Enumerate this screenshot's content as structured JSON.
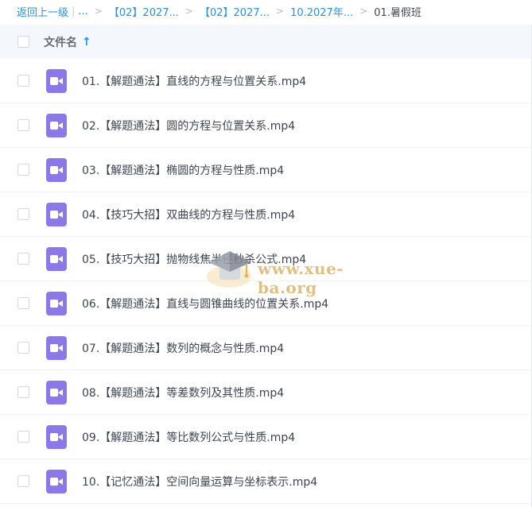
{
  "breadcrumb": {
    "back_label": "返回上一级",
    "ellipsis": "...",
    "items": [
      {
        "label": "【02】2027..."
      },
      {
        "label": "【02】2027..."
      },
      {
        "label": "10.2027年..."
      }
    ],
    "current": "01.暑假班",
    "separator": ">",
    "divider": "|"
  },
  "header": {
    "column_label": "文件名",
    "sort_icon": "arrow-up-icon",
    "sort_glyph": "↑"
  },
  "files": [
    {
      "name": "01.【解题通法】直线的方程与位置关系.mp4",
      "icon": "video-file-icon"
    },
    {
      "name": "02.【解题通法】圆的方程与位置关系.mp4",
      "icon": "video-file-icon"
    },
    {
      "name": "03.【解题通法】椭圆的方程与性质.mp4",
      "icon": "video-file-icon"
    },
    {
      "name": "04.【技巧大招】双曲线的方程与性质.mp4",
      "icon": "video-file-icon"
    },
    {
      "name": "05.【技巧大招】抛物线焦半径秒杀公式.mp4",
      "icon": "video-file-icon"
    },
    {
      "name": "06.【解题通法】直线与圆锥曲线的位置关系.mp4",
      "icon": "video-file-icon"
    },
    {
      "name": "07.【解题通法】数列的概念与性质.mp4",
      "icon": "video-file-icon"
    },
    {
      "name": "08.【解题通法】等差数列及其性质.mp4",
      "icon": "video-file-icon"
    },
    {
      "name": "09.【解题通法】等比数列公式与性质.mp4",
      "icon": "video-file-icon"
    },
    {
      "name": "10.【记忆通法】空间向量运算与坐标表示.mp4",
      "icon": "video-file-icon"
    }
  ],
  "watermark": {
    "text": "www.xue-ba.org",
    "icon": "graduation-cap-icon"
  },
  "colors": {
    "link": "#2a8fe6",
    "header_bg": "#f4f8fc",
    "video_icon": "#8c78e8"
  }
}
